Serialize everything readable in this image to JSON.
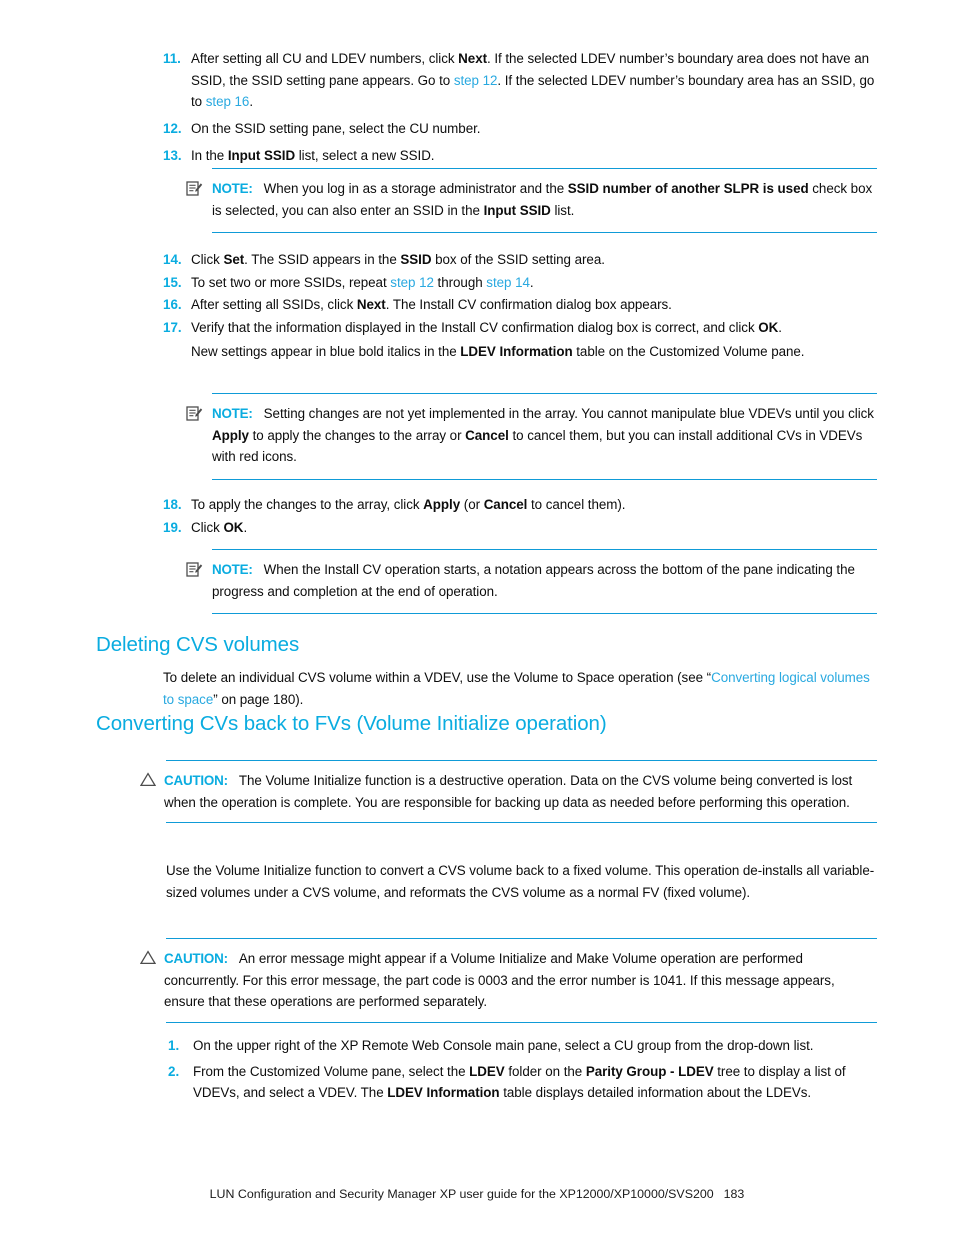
{
  "steps_top": [
    {
      "number": "11.",
      "lines": [
        "After setting all CU and LDEV numbers, click ",
        "Next",
        ". If the selected LDEV number’s boundary area does not have an SSID, the SSID setting pane appears. Go to ",
        "step 12",
        ". If the selected LDEV number’s boundary area has an SSID, go to ",
        "step 16",
        "."
      ]
    },
    {
      "number": "12.",
      "text": "On the SSID setting pane, select the CU number."
    },
    {
      "number": "13.",
      "pre": "In the ",
      "bold": "Input SSID",
      "post": " list, select a new SSID."
    }
  ],
  "note_1": {
    "icon": "note-icon",
    "label": "NOTE:",
    "parts": [
      "When you log in as a storage administrator and the ",
      "SSID number of another SLPR is used",
      " check box is selected, you can also enter an SSID in the ",
      "Input SSID",
      " list."
    ]
  },
  "steps_mid": [
    {
      "number": "14.",
      "parts": [
        "Click ",
        "Set",
        ". The SSID appears in the ",
        "SSID",
        " box of the SSID setting area."
      ]
    },
    {
      "number": "15.",
      "parts": [
        "To set two or more SSIDs, repeat ",
        "step 12",
        " through ",
        "step 14",
        "."
      ]
    },
    {
      "number": "16.",
      "parts": [
        "After setting all SSIDs, click ",
        "Next",
        ". The Install CV confirmation dialog box appears."
      ]
    },
    {
      "number": "17.",
      "parts": [
        "Verify that the information displayed in the Install CV confirmation dialog box is correct, and click ",
        "OK",
        "."
      ],
      "second_line": [
        "New settings appear in blue bold italics in the ",
        "LDEV Information",
        " table on the Customized Volume pane."
      ]
    }
  ],
  "note_2": {
    "icon": "note-icon",
    "label": "NOTE:",
    "parts": [
      "Setting changes are not yet implemented in the array. You cannot manipulate blue VDEVs until you click ",
      "Apply",
      " to apply the changes to the array or ",
      "Cancel",
      " to cancel them, but you can install additional CVs in VDEVs with red icons."
    ]
  },
  "steps_bottom": [
    {
      "number": "18.",
      "parts": [
        "To apply the changes to the array, click ",
        "Apply",
        " (or ",
        "Cancel",
        " to cancel them)."
      ]
    },
    {
      "number": "19.",
      "parts": [
        "Click ",
        "OK",
        "."
      ]
    }
  ],
  "note_3": {
    "icon": "note-icon",
    "label": "NOTE:",
    "text": "When the Install CV operation starts, a notation appears across the bottom of the pane indicating the progress and completion at the end of operation."
  },
  "heading_1": "Deleting CVS volumes",
  "paragraph_1": {
    "pre": "To delete an individual CVS volume within a VDEV, use the Volume to Space operation (see “",
    "link": "Converting logical volumes to space",
    "post": "” on page 180)."
  },
  "heading_2": "Converting CVs back to FVs (Volume Initialize operation)",
  "caution_1": {
    "icon": "caution-triangle-icon",
    "label": "CAUTION:",
    "text": "The Volume Initialize function is a destructive operation. Data on the CVS volume being converted is lost when the operation is complete. You are responsible for backing up data as needed before performing this operation."
  },
  "paragraph_2": "Use the Volume Initialize function to convert a CVS volume back to a fixed volume. This operation de-installs all variable-sized volumes under a CVS volume, and reformats the CVS volume as a normal FV (fixed volume).",
  "caution_2": {
    "icon": "caution-triangle-icon",
    "label": "CAUTION:",
    "text": "An error message might appear if a Volume Initialize and Make Volume operation are performed concurrently. For this error message, the part code is 0003 and the error number is 1041. If this message appears, ensure that these operations are performed separately."
  },
  "steps_final": [
    {
      "number": "1.",
      "text": "On the upper right of the XP Remote Web Console main pane, select a CU group from the drop-down list."
    },
    {
      "number": "2.",
      "parts": [
        "From the Customized Volume pane, select the ",
        "LDEV",
        " folder on the ",
        "Parity Group - LDEV",
        " tree to display a list of VDEVs, and select a VDEV. The ",
        "LDEV Information",
        " table displays detailed information about the LDEVs."
      ]
    }
  ],
  "footer": {
    "text": "LUN Configuration and Security Manager XP user guide for the XP12000/XP10000/SVS200",
    "page_number": "183"
  },
  "colors": {
    "accent_blue": "#0aace0",
    "rule_blue": "#0f9bd7",
    "link_blue": "#29a9e0",
    "text": "#0d0d0d"
  }
}
